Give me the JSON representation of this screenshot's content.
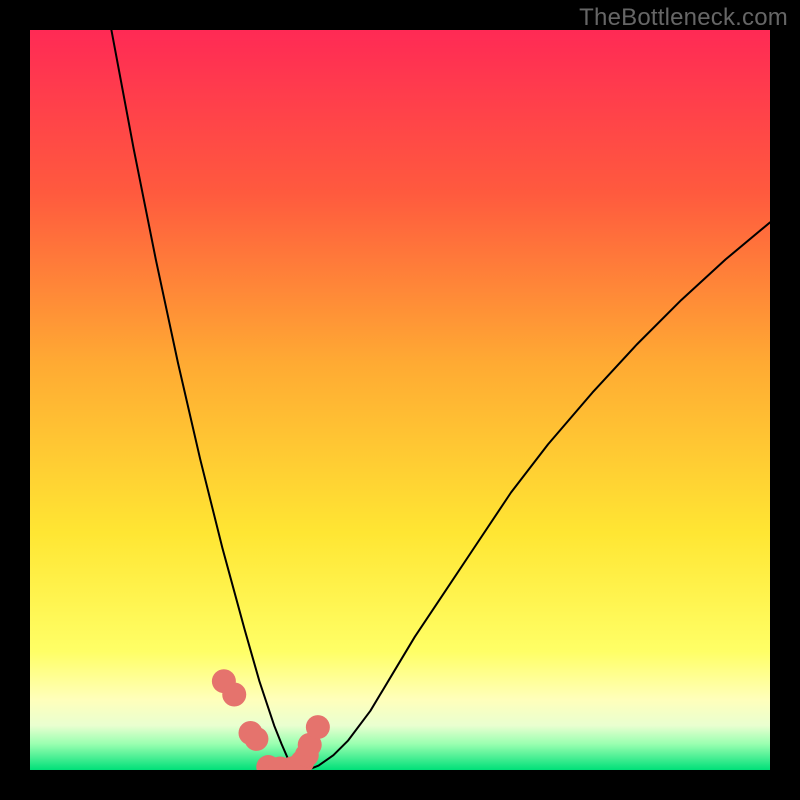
{
  "watermark": "TheBottleneck.com",
  "chart_data": {
    "type": "line",
    "title": "",
    "xlabel": "",
    "ylabel": "",
    "xlim": [
      0,
      100
    ],
    "ylim": [
      0,
      100
    ],
    "background_gradient": {
      "stops": [
        {
          "offset": 0.0,
          "color": "#ff2a55"
        },
        {
          "offset": 0.22,
          "color": "#ff5a3e"
        },
        {
          "offset": 0.45,
          "color": "#ffaa33"
        },
        {
          "offset": 0.68,
          "color": "#ffe633"
        },
        {
          "offset": 0.84,
          "color": "#ffff66"
        },
        {
          "offset": 0.905,
          "color": "#ffffbb"
        },
        {
          "offset": 0.94,
          "color": "#e9ffd0"
        },
        {
          "offset": 0.965,
          "color": "#99ffb0"
        },
        {
          "offset": 1.0,
          "color": "#00e079"
        }
      ]
    },
    "series": [
      {
        "name": "curve",
        "stroke": "#000000",
        "stroke_width": 2,
        "x": [
          11.0,
          12.5,
          14.0,
          15.5,
          17.0,
          18.5,
          20.0,
          21.5,
          23.0,
          24.5,
          26.0,
          27.5,
          29.0,
          30.0,
          31.0,
          32.0,
          33.0,
          34.0,
          35.0,
          36.0,
          37.5,
          39.0,
          41.0,
          43.0,
          46.0,
          49.0,
          52.0,
          56.0,
          60.0,
          65.0,
          70.0,
          76.0,
          82.0,
          88.0,
          94.0,
          100.0
        ],
        "y": [
          100.0,
          92.0,
          84.0,
          76.5,
          69.0,
          62.0,
          55.0,
          48.5,
          42.0,
          36.0,
          30.0,
          24.5,
          19.0,
          15.5,
          12.0,
          9.0,
          6.0,
          3.5,
          1.2,
          0.0,
          0.0,
          0.6,
          2.0,
          4.0,
          8.0,
          13.0,
          18.0,
          24.0,
          30.0,
          37.5,
          44.0,
          51.0,
          57.5,
          63.5,
          69.0,
          74.0
        ]
      }
    ],
    "marker_series": {
      "name": "dots",
      "color": "#e5736d",
      "radius_px": 12,
      "x": [
        26.2,
        27.6,
        29.8,
        30.6,
        32.2,
        33.8,
        35.4,
        36.2,
        36.8,
        37.4,
        37.8,
        38.9
      ],
      "y": [
        12.0,
        10.2,
        5.0,
        4.2,
        0.4,
        0.2,
        0.2,
        0.5,
        1.1,
        2.0,
        3.4,
        5.8
      ]
    }
  }
}
